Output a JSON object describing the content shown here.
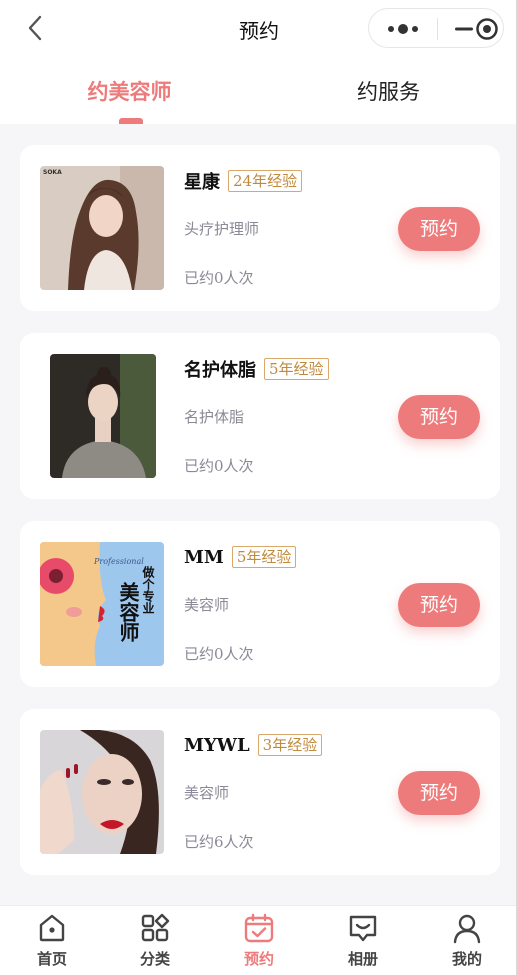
{
  "nav": {
    "title": "预约",
    "back_icon": "chevron-left-icon",
    "capsule_icons": [
      "more-dots-icon",
      "minimize-icon",
      "target-icon"
    ]
  },
  "tabs": [
    {
      "label": "约美容师",
      "active": true
    },
    {
      "label": "约服务",
      "active": false
    }
  ],
  "accent_color": "#ee7b7b",
  "beauticians": [
    {
      "name": "星康",
      "experience": "24年经验",
      "role": "头疗护理师",
      "booked": "已约0人次",
      "button": "预约",
      "photo": "woman-portrait-long-hair"
    },
    {
      "name": "名护体脂",
      "experience": "5年经验",
      "role": "名护体脂",
      "booked": "已约0人次",
      "button": "预约",
      "photo": "woman-portrait-grey-sweater"
    },
    {
      "name": "MM",
      "experience": "5年经验",
      "role": "美容师",
      "booked": "已约0人次",
      "button": "预约",
      "photo": "professional-beautician-poster"
    },
    {
      "name": "MYWL",
      "experience": "3年经验",
      "role": "美容师",
      "booked": "已约6人次",
      "button": "预约",
      "photo": "woman-makeup-red-lips"
    }
  ],
  "poster_text": {
    "line1": "做个专业",
    "line2": "美容师",
    "script": "Professional"
  },
  "photo_brand_text": "SOKA",
  "bottom_tabs": [
    {
      "label": "首页",
      "icon": "home-icon",
      "active": false
    },
    {
      "label": "分类",
      "icon": "category-icon",
      "active": false
    },
    {
      "label": "预约",
      "icon": "calendar-check-icon",
      "active": true
    },
    {
      "label": "相册",
      "icon": "album-icon",
      "active": false
    },
    {
      "label": "我的",
      "icon": "user-icon",
      "active": false
    }
  ]
}
